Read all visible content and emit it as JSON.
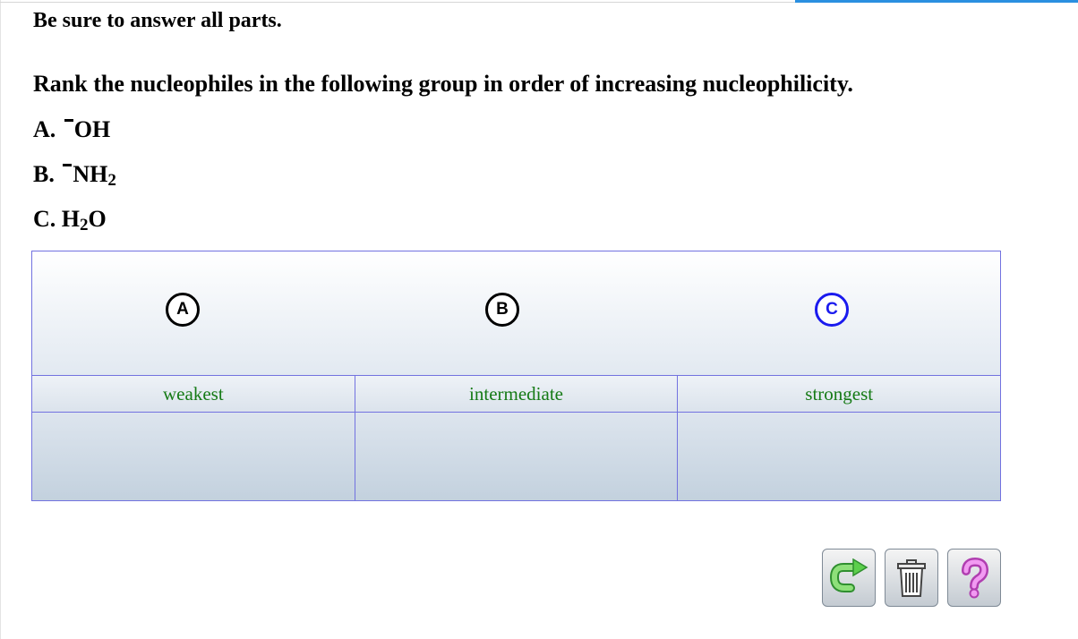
{
  "instructions": "Be sure to answer all parts.",
  "question": "Rank the nucleophiles in the following group in order of increasing nucleophilicity.",
  "options": [
    {
      "prefix": "A.",
      "formula": "OH",
      "sub": "",
      "tail": ""
    },
    {
      "prefix": "B.",
      "formula": "NH",
      "sub": "2",
      "tail": ""
    },
    {
      "prefix": "C. H",
      "formula": "",
      "sub": "2",
      "tail": "O"
    }
  ],
  "tokens": [
    "A",
    "B",
    "C"
  ],
  "rank_labels": [
    "weakest",
    "intermediate",
    "strongest"
  ],
  "colors": {
    "border": "#7272e0",
    "label_text": "#157a15",
    "selected_token": "#1a1aee",
    "top_accent": "#2a8fe0"
  },
  "toolbar": [
    {
      "name": "reset-icon"
    },
    {
      "name": "trash-icon"
    },
    {
      "name": "help-icon"
    }
  ]
}
